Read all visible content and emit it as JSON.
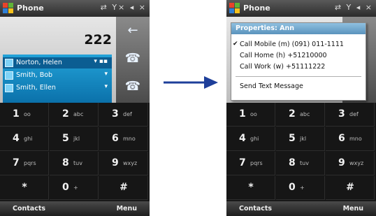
{
  "left_screen": {
    "title": "Phone",
    "status_icons": "⇄ Y× ◂ ×",
    "dialed_number": "222",
    "side_buttons": [
      "←",
      "☎",
      "☎"
    ],
    "matches": [
      {
        "name": "Norton, Helen"
      },
      {
        "name": "Smith, Bob"
      },
      {
        "name": "Smith, Ellen"
      }
    ],
    "softkeys": {
      "left": "Contacts",
      "right": "Menu"
    }
  },
  "right_screen": {
    "title": "Phone",
    "status_icons": "⇄ Y ◂ ×",
    "popup": {
      "header": "Properties: Ann",
      "items": [
        {
          "label": "Call Mobile (m) (091) 011-1111",
          "checked": true
        },
        {
          "label": "Call Home (h) +51210000",
          "checked": false
        },
        {
          "label": "Call Work (w) +51111222",
          "checked": false
        },
        {
          "label": "Send Text Message",
          "checked": false
        }
      ]
    },
    "softkeys": {
      "left": "Contacts",
      "right": "Menu"
    }
  },
  "keypad": [
    {
      "digit": "1",
      "letters": "oo"
    },
    {
      "digit": "2",
      "letters": "abc"
    },
    {
      "digit": "3",
      "letters": "def"
    },
    {
      "digit": "4",
      "letters": "ghi"
    },
    {
      "digit": "5",
      "letters": "jkl"
    },
    {
      "digit": "6",
      "letters": "mno"
    },
    {
      "digit": "7",
      "letters": "pqrs"
    },
    {
      "digit": "8",
      "letters": "tuv"
    },
    {
      "digit": "9",
      "letters": "wxyz"
    },
    {
      "digit": "*",
      "letters": ""
    },
    {
      "digit": "0",
      "letters": "+"
    },
    {
      "digit": "#",
      "letters": ""
    }
  ],
  "colors": {
    "accent": "#1e5cbf",
    "match_bg": "#22a2d8",
    "popup_header": "#5a93bd"
  }
}
